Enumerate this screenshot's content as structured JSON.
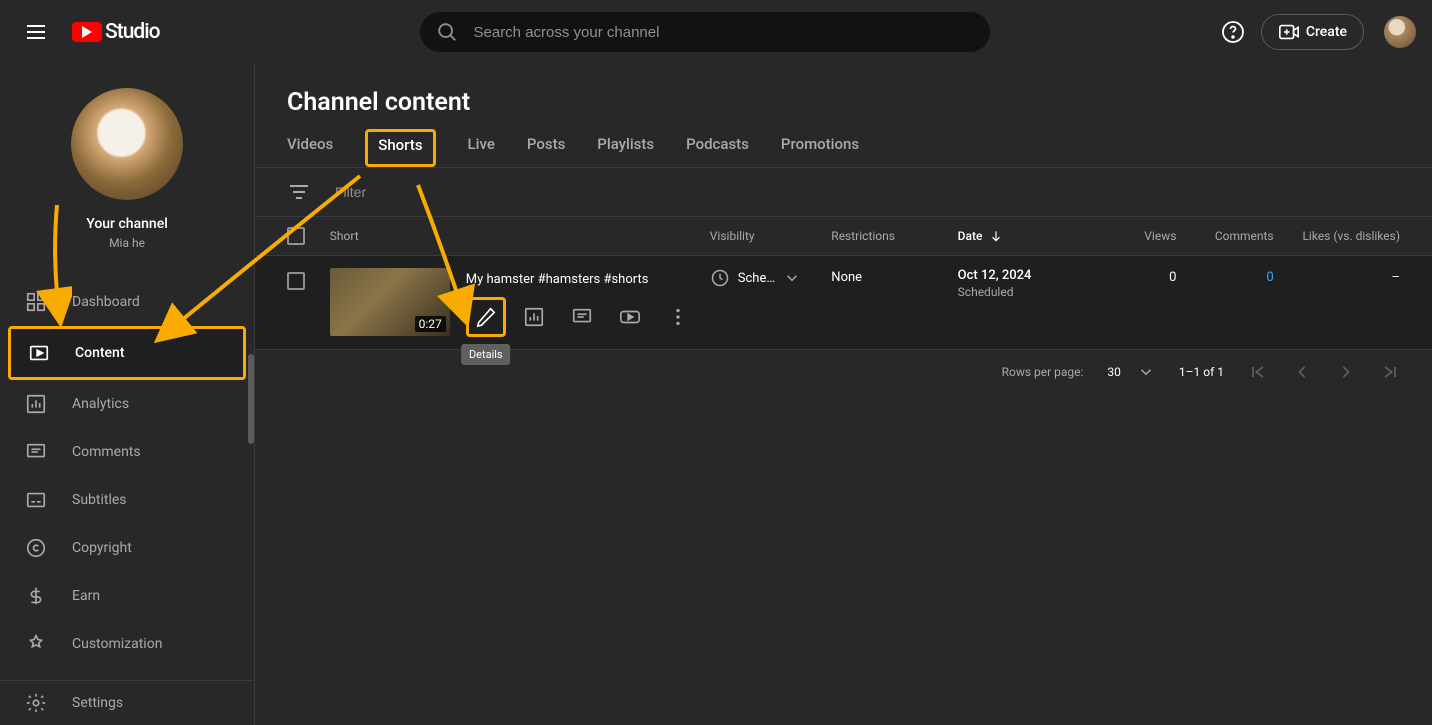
{
  "header": {
    "logo_text": "Studio",
    "search_placeholder": "Search across your channel",
    "create_label": "Create"
  },
  "channel": {
    "label": "Your channel",
    "name": "Mia he"
  },
  "nav": {
    "dashboard": "Dashboard",
    "content": "Content",
    "analytics": "Analytics",
    "comments": "Comments",
    "subtitles": "Subtitles",
    "copyright": "Copyright",
    "earn": "Earn",
    "customization": "Customization",
    "settings": "Settings"
  },
  "page": {
    "title": "Channel content"
  },
  "tabs": {
    "videos": "Videos",
    "shorts": "Shorts",
    "live": "Live",
    "posts": "Posts",
    "playlists": "Playlists",
    "podcasts": "Podcasts",
    "promotions": "Promotions"
  },
  "filter": {
    "placeholder": "Filter"
  },
  "columns": {
    "short": "Short",
    "visibility": "Visibility",
    "restrictions": "Restrictions",
    "date": "Date",
    "views": "Views",
    "comments": "Comments",
    "likes": "Likes (vs. dislikes)"
  },
  "rows": [
    {
      "title": "My hamster #hamsters #shorts",
      "duration": "0:27",
      "visibility": "Sche…",
      "restrictions": "None",
      "date": "Oct 12, 2024",
      "date_status": "Scheduled",
      "views": "0",
      "comments": "0",
      "likes": "–"
    }
  ],
  "tooltip": {
    "details": "Details"
  },
  "pagination": {
    "label": "Rows per page:",
    "per_page": "30",
    "range": "1–1 of 1"
  },
  "annotation_color": "#f9ab00"
}
